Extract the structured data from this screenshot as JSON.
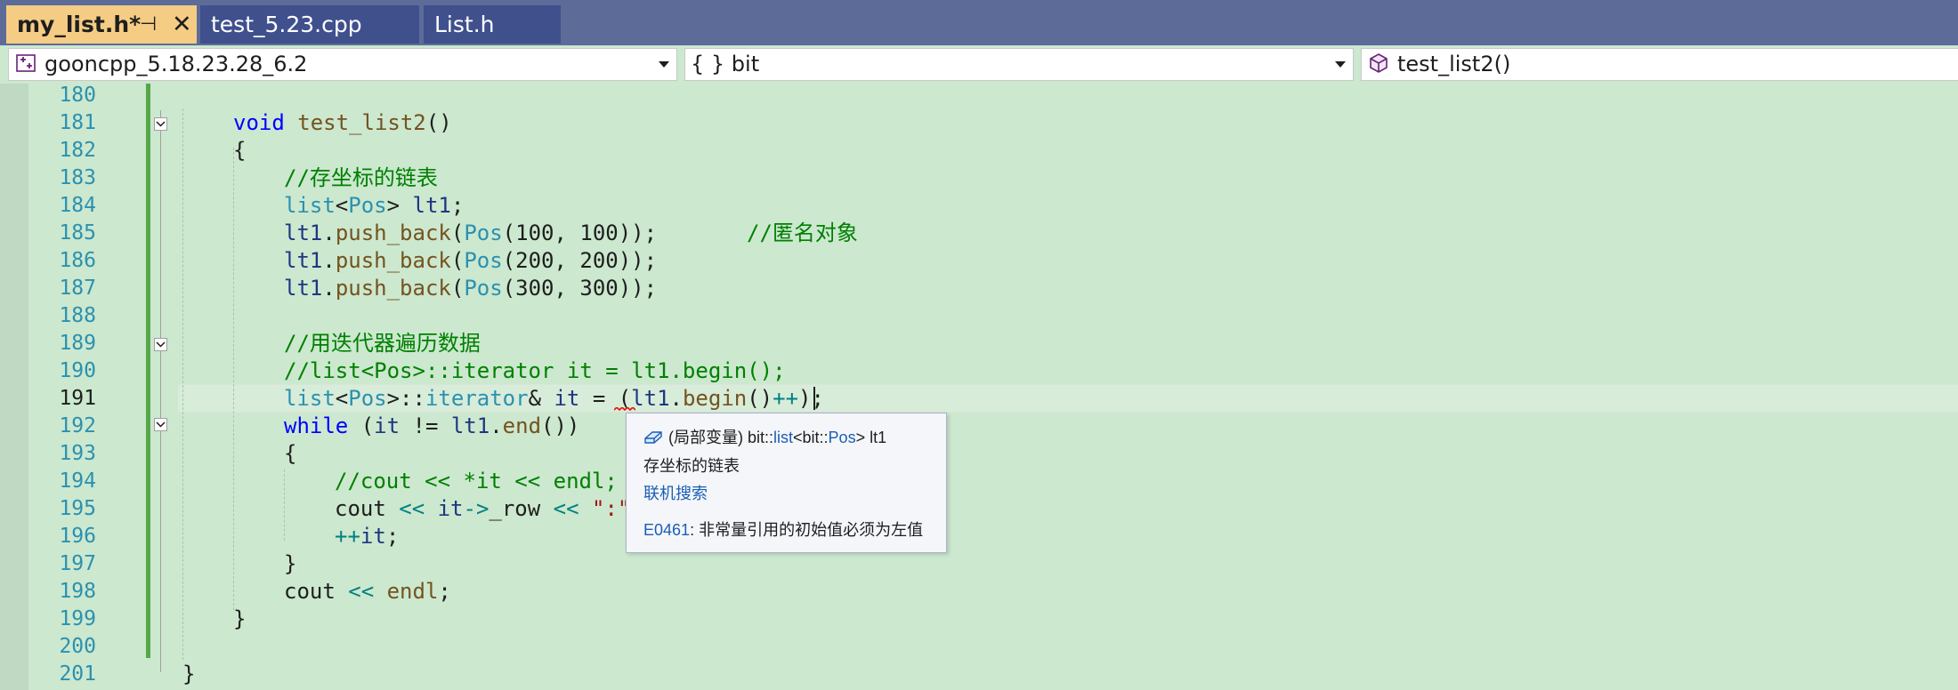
{
  "tabs": [
    {
      "label": "my_list.h*",
      "pin_glyph": "⊣",
      "close_glyph": "✕",
      "active": true
    },
    {
      "label": "test_5.23.cpp",
      "active": false
    },
    {
      "label": "List.h",
      "active": false
    }
  ],
  "navbar": {
    "project": "gooncpp_5.18.23.28_6.2",
    "scope": "{ } bit",
    "member": "test_list2()"
  },
  "editor": {
    "current_line": "191",
    "lines": [
      {
        "n": "180"
      },
      {
        "n": "181",
        "t": [
          "void",
          " ",
          "test_list2",
          "()"
        ]
      },
      {
        "n": "182",
        "t": [
          "{"
        ]
      },
      {
        "n": "183",
        "t": [
          "//存坐标的链表"
        ]
      },
      {
        "n": "184",
        "t": [
          "list",
          "<",
          "Pos",
          "> ",
          "lt1",
          ";"
        ]
      },
      {
        "n": "185",
        "t": [
          "lt1",
          ".",
          "push_back",
          "(",
          "Pos",
          "(100, 100));",
          "//匿名对象"
        ]
      },
      {
        "n": "186",
        "t": [
          "lt1",
          ".",
          "push_back",
          "(",
          "Pos",
          "(200, 200));"
        ]
      },
      {
        "n": "187",
        "t": [
          "lt1",
          ".",
          "push_back",
          "(",
          "Pos",
          "(300, 300));"
        ]
      },
      {
        "n": "188"
      },
      {
        "n": "189",
        "t": [
          "//用迭代器遍历数据"
        ]
      },
      {
        "n": "190",
        "t": [
          "//list<Pos>::iterator it = lt1.begin();"
        ]
      },
      {
        "n": "191",
        "t": [
          "list",
          "<",
          "Pos",
          ">::",
          "iterator",
          "& ",
          "it",
          " = (",
          "lt1",
          ".",
          "begin",
          "()",
          "++",
          ")",
          ";"
        ]
      },
      {
        "n": "192",
        "t": [
          "while",
          " (",
          "it",
          " != ",
          "lt1",
          ".",
          "end",
          "())"
        ]
      },
      {
        "n": "193",
        "t": [
          "{"
        ]
      },
      {
        "n": "194",
        "t": [
          "//cout << *it << endl;"
        ]
      },
      {
        "n": "195",
        "t": [
          "cout",
          " << ",
          "it",
          "->",
          "_row",
          " << ",
          "\":\""
        ]
      },
      {
        "n": "196",
        "t": [
          "++",
          "it",
          ";"
        ]
      },
      {
        "n": "197",
        "t": [
          "}"
        ]
      },
      {
        "n": "198",
        "t": [
          "cout",
          " << ",
          "endl",
          ";"
        ]
      },
      {
        "n": "199",
        "t": [
          "}"
        ]
      },
      {
        "n": "200"
      },
      {
        "n": "201",
        "t": [
          "}"
        ]
      }
    ]
  },
  "tooltip": {
    "decl_prefix": "(局部变量) bit::",
    "decl_type": "list",
    "decl_mid": "<bit::",
    "decl_arg": "Pos",
    "decl_suffix": "> lt1",
    "description": "存坐标的链表",
    "search_link": "联机搜索",
    "error_code": "E0461",
    "error_message": ": 非常量引用的初始值必须为左值"
  },
  "colors": {
    "editor_background": "#cce8cf",
    "tabbar_background": "#5d6b99",
    "active_tab": "#f5cc84",
    "keyword": "#0000ff",
    "comment": "#008000",
    "type": "#2b91af",
    "function": "#74531f"
  },
  "icons": [
    "pin-icon",
    "close-icon",
    "project-icon",
    "namespace-icon",
    "cube-icon",
    "dropdown-arrow-icon",
    "fold-collapse-icon",
    "variable-icon"
  ]
}
